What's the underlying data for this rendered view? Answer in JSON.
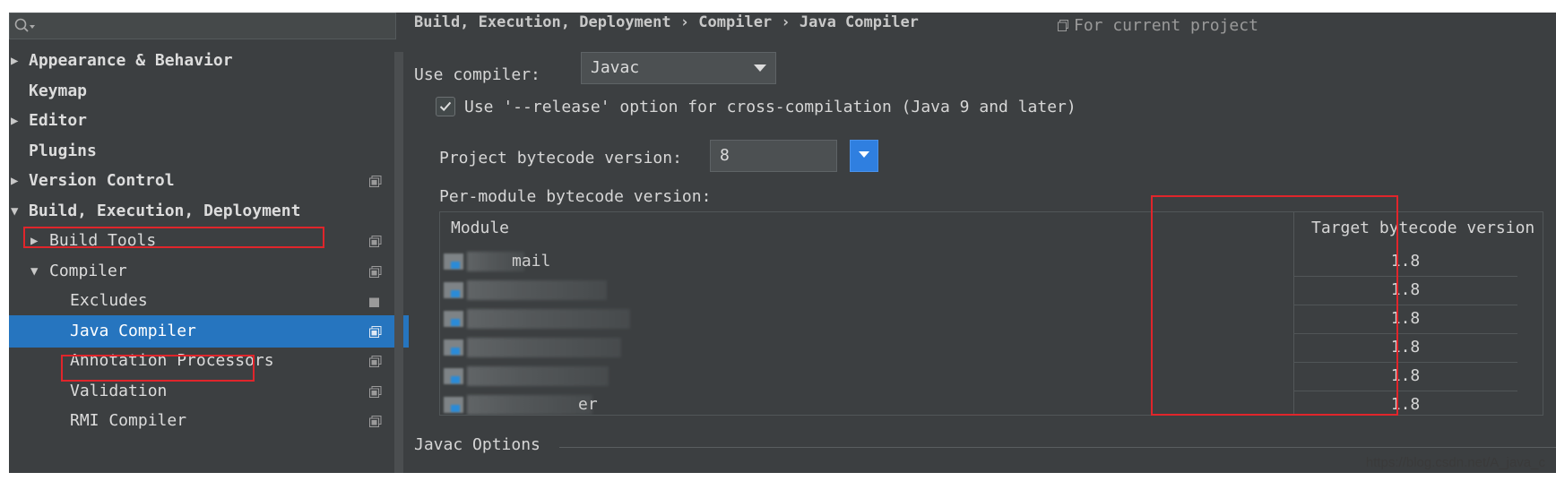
{
  "sidebar": {
    "search_placeholder": "",
    "items": [
      {
        "label": "Appearance & Behavior",
        "arrow": "▶",
        "bold": true
      },
      {
        "label": "Keymap",
        "arrow": "",
        "bold": true
      },
      {
        "label": "Editor",
        "arrow": "▶",
        "bold": true
      },
      {
        "label": "Plugins",
        "arrow": "",
        "bold": true
      },
      {
        "label": "Version Control",
        "arrow": "▶",
        "bold": true
      },
      {
        "label": "Build, Execution, Deployment",
        "arrow": "▼",
        "bold": true
      },
      {
        "label": "Build Tools",
        "arrow": "▶",
        "bold": false
      },
      {
        "label": "Compiler",
        "arrow": "▼",
        "bold": false
      },
      {
        "label": "Excludes",
        "arrow": "",
        "bold": false
      },
      {
        "label": "Java Compiler",
        "arrow": "",
        "bold": false,
        "selected": true
      },
      {
        "label": "Annotation Processors",
        "arrow": "",
        "bold": false
      },
      {
        "label": "Validation",
        "arrow": "",
        "bold": false
      },
      {
        "label": "RMI Compiler",
        "arrow": "",
        "bold": false
      }
    ]
  },
  "header": {
    "breadcrumb": "Build, Execution, Deployment  ›  Compiler  ›  Java Compiler",
    "scope_note": "For current project"
  },
  "compiler": {
    "use_compiler_label": "Use compiler:",
    "use_compiler_value": "Javac",
    "release_option_label": "Use '--release' option for cross-compilation (Java 9 and later)",
    "release_option_checked": true,
    "project_bytecode_label": "Project bytecode version:",
    "project_bytecode_value": "8",
    "per_module_label": "Per-module bytecode version:"
  },
  "module_table": {
    "columns": [
      "Module",
      "Target bytecode version"
    ],
    "rows": [
      {
        "module_visible": "mail",
        "target": "1.8"
      },
      {
        "module_visible": "",
        "target": "1.8"
      },
      {
        "module_visible": "",
        "target": "1.8"
      },
      {
        "module_visible": "",
        "target": "1.8"
      },
      {
        "module_visible": "",
        "target": "1.8"
      },
      {
        "module_visible": "er",
        "target": "1.8"
      }
    ]
  },
  "javac_options_label": "Javac Options",
  "watermark": "https://blog.csdn.net/A_java_c",
  "colors": {
    "panel_bg": "#3c3f41",
    "selection": "#2675bf",
    "annotation_red": "#e0252b",
    "combo_accent": "#2f7fe0"
  }
}
